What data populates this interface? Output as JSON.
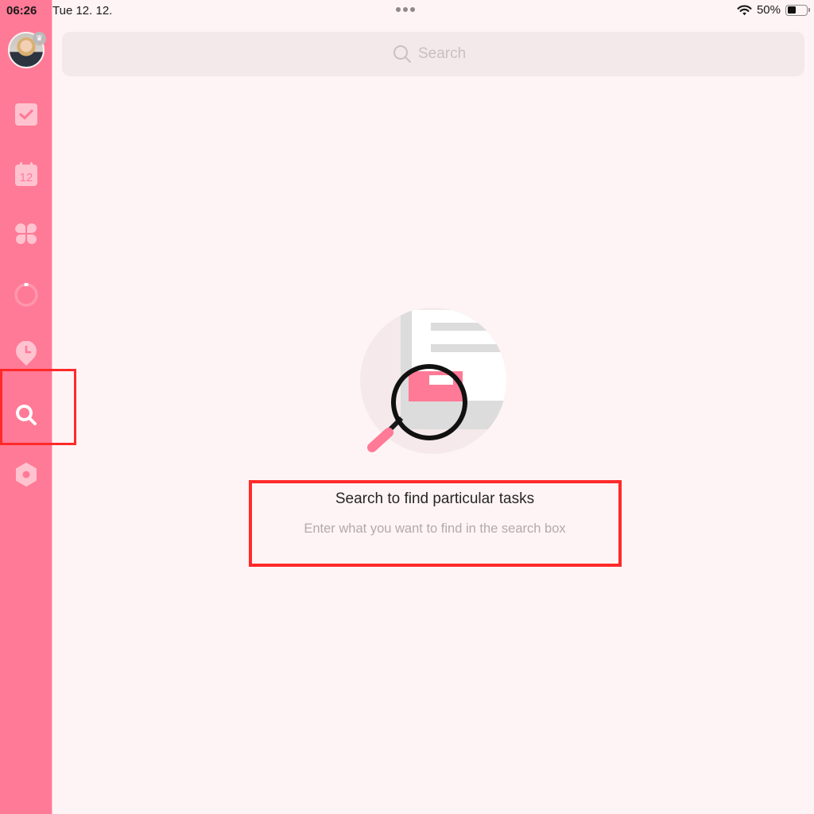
{
  "status_bar": {
    "time": "06:26",
    "date": "Tue 12. 12.",
    "battery_percent_label": "50%",
    "battery_level": 0.5,
    "wifi_icon": "wifi-icon",
    "multitask_icon": "ellipsis-icon"
  },
  "sidebar": {
    "avatar": {
      "name": "user-avatar",
      "badge_icon": "crown-icon",
      "badge_glyph": "♛"
    },
    "items": [
      {
        "id": "tasks",
        "icon": "checkbox-icon",
        "active": false
      },
      {
        "id": "calendar",
        "icon": "calendar-icon",
        "calendar_day": "12",
        "active": false
      },
      {
        "id": "matrix",
        "icon": "four-leaf-icon",
        "active": false
      },
      {
        "id": "focus",
        "icon": "pomodoro-ring-icon",
        "active": false
      },
      {
        "id": "habit",
        "icon": "clock-pin-icon",
        "active": false
      },
      {
        "id": "search",
        "icon": "search-icon",
        "active": true
      },
      {
        "id": "settings",
        "icon": "settings-hexagon-icon",
        "active": false
      }
    ]
  },
  "search": {
    "placeholder": "Search",
    "value": ""
  },
  "empty_state": {
    "illustration": "magnifier-over-document-illustration",
    "title": "Search to find particular tasks",
    "subtitle": "Enter what you want to find in the search box"
  },
  "colors": {
    "sidebar": "#FF7A96",
    "background": "#FFF4F5",
    "search_field": "#F3E8EA",
    "accent": "#FF7A96",
    "annotation": "#FF2A2A"
  },
  "annotations": [
    {
      "target": "sidebar-item-search",
      "type": "highlight-box"
    },
    {
      "target": "empty-state-text",
      "type": "highlight-box"
    }
  ]
}
